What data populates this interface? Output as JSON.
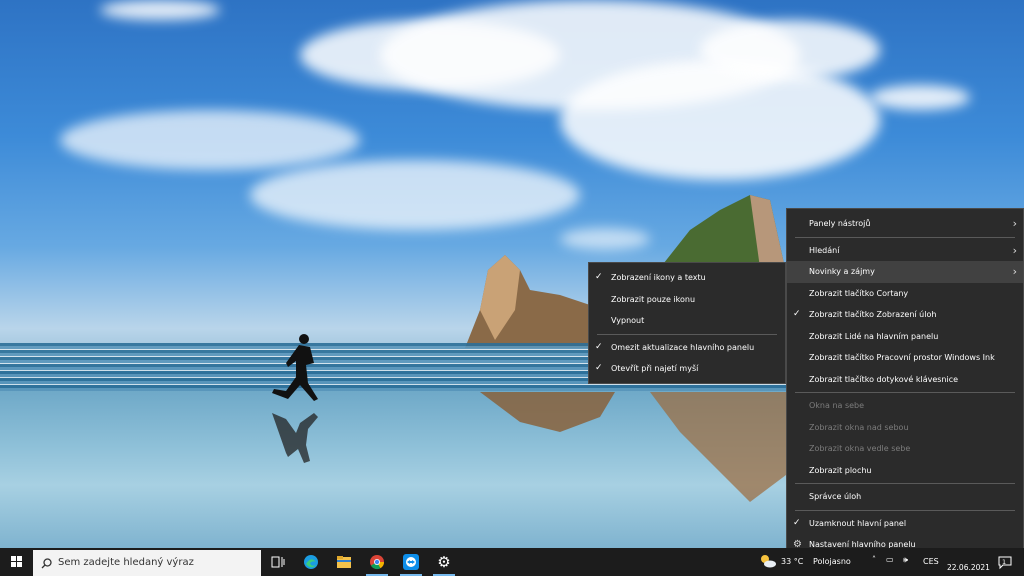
{
  "context_menu": {
    "items": [
      {
        "label": "Panely nástrojů",
        "submenu": true,
        "checked": false,
        "disabled": false
      },
      {
        "separator": true
      },
      {
        "label": "Hledání",
        "submenu": true,
        "checked": false,
        "disabled": false
      },
      {
        "label": "Novinky a zájmy",
        "submenu": true,
        "checked": false,
        "disabled": false,
        "highlighted": true
      },
      {
        "label": "Zobrazit tlačítko Cortany",
        "checked": false,
        "disabled": false
      },
      {
        "label": "Zobrazit tlačítko Zobrazení úloh",
        "checked": true,
        "disabled": false
      },
      {
        "label": "Zobrazit Lidé na hlavním panelu",
        "checked": false,
        "disabled": false
      },
      {
        "label": "Zobrazit tlačítko Pracovní prostor Windows Ink",
        "checked": false,
        "disabled": false
      },
      {
        "label": "Zobrazit tlačítko dotykové klávesnice",
        "checked": false,
        "disabled": false
      },
      {
        "separator": true
      },
      {
        "label": "Okna na sebe",
        "checked": false,
        "disabled": true
      },
      {
        "label": "Zobrazit okna nad sebou",
        "checked": false,
        "disabled": true
      },
      {
        "label": "Zobrazit okna vedle sebe",
        "checked": false,
        "disabled": true
      },
      {
        "label": "Zobrazit plochu",
        "checked": false,
        "disabled": false
      },
      {
        "separator": true
      },
      {
        "label": "Správce úloh",
        "checked": false,
        "disabled": false
      },
      {
        "separator": true
      },
      {
        "label": "Uzamknout hlavní panel",
        "checked": true,
        "disabled": false
      },
      {
        "label": "Nastavení hlavního panelu",
        "checked": false,
        "disabled": false,
        "icon": "gear-icon"
      }
    ]
  },
  "submenu": {
    "items": [
      {
        "label": "Zobrazení ikony a textu",
        "checked": true
      },
      {
        "label": "Zobrazit pouze ikonu",
        "checked": false
      },
      {
        "label": "Vypnout",
        "checked": false
      },
      {
        "separator": true
      },
      {
        "label": "Omezit aktualizace hlavního panelu",
        "checked": true
      },
      {
        "label": "Otevřít při najetí myší",
        "checked": true
      }
    ]
  },
  "taskbar": {
    "search_placeholder": "Sem zadejte hledaný výraz",
    "apps": [
      {
        "name": "task-view-icon",
        "active": false
      },
      {
        "name": "edge-icon",
        "active": false
      },
      {
        "name": "file-explorer-icon",
        "active": false
      },
      {
        "name": "chrome-icon",
        "active": true
      },
      {
        "name": "teamviewer-icon",
        "active": true
      },
      {
        "name": "settings-icon",
        "active": true
      }
    ],
    "weather_temp": "33 °C",
    "weather_desc": "Polojasno",
    "lang": "CES",
    "date": "22.06.2021",
    "notification_count": "1"
  },
  "colors": {
    "menu_bg": "#2b2b2b",
    "menu_highlight": "#414141",
    "taskbar_bg": "#1c1c1c",
    "accent": "#76b9ed"
  }
}
